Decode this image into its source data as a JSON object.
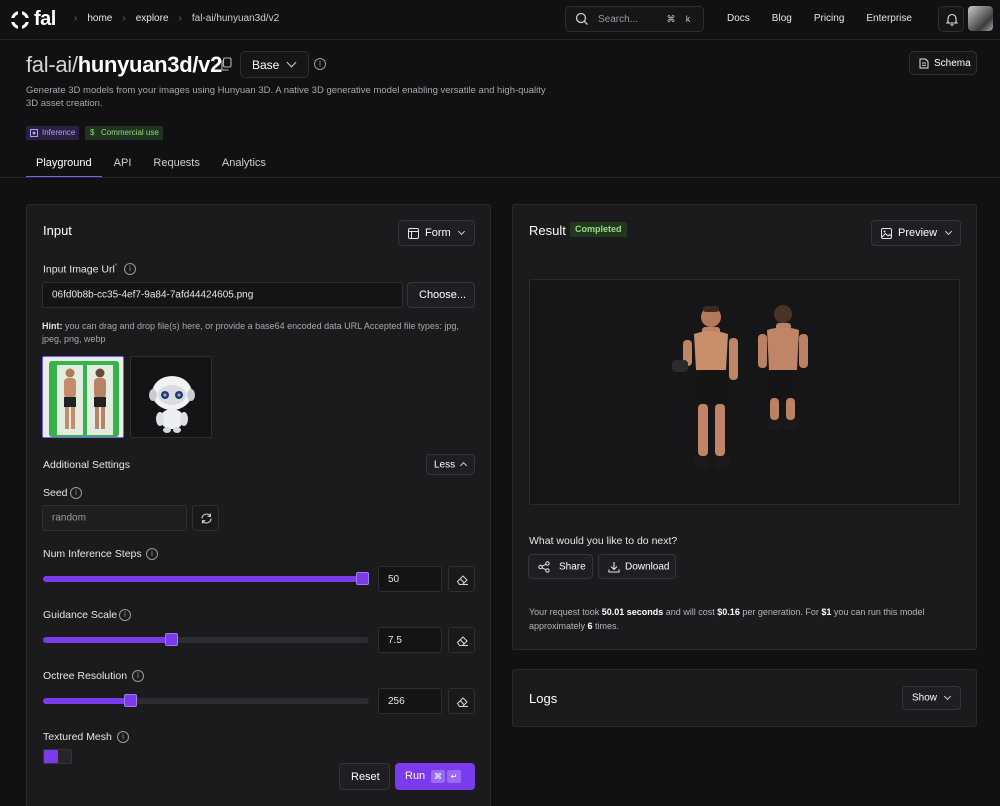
{
  "nav": {
    "logo": "fal",
    "breadcrumbs": [
      "home",
      "explore",
      "fal-ai/hunyuan3d/v2"
    ],
    "search_placeholder": "Search...",
    "search_kbd": [
      "⌘",
      "k"
    ],
    "links": [
      "Docs",
      "Blog",
      "Pricing",
      "Enterprise"
    ]
  },
  "model": {
    "owner": "fal-ai/",
    "name": "hunyuan3d/v2",
    "variant": "Base",
    "schema_label": "Schema",
    "description": "Generate 3D models from your images using Hunyuan 3D. A native 3D generative model enabling versatile and high-quality 3D asset creation.",
    "badges": [
      "Inference",
      "Commercial use"
    ]
  },
  "tabs": [
    "Playground",
    "API",
    "Requests",
    "Analytics"
  ],
  "input": {
    "title": "Input",
    "mode": "Form",
    "image_url_label": "Input Image Url",
    "image_url_required": "*",
    "image_url_value": "06fd0b8b-cc35-4ef7-9a84-7afd44424605.png",
    "choose_label": "Choose...",
    "hint_bold": "Hint:",
    "hint_text": " you can drag and drop file(s) here, or provide a base64 encoded data URL Accepted file types: jpg, jpeg, png, webp",
    "additional_settings": "Additional Settings",
    "less_label": "Less",
    "seed_label": "Seed",
    "seed_placeholder": "random",
    "steps_label": "Num Inference Steps",
    "steps_value": "50",
    "steps_fraction": 1.0,
    "guidance_label": "Guidance Scale",
    "guidance_value": "7.5",
    "guidance_fraction": 0.39,
    "octree_label": "Octree Resolution",
    "octree_value": "256",
    "octree_fraction": 0.26,
    "textured_label": "Textured Mesh",
    "reset_label": "Reset",
    "run_label": "Run",
    "run_kbd": [
      "⌘",
      "↵"
    ]
  },
  "result": {
    "title": "Result",
    "status": "Completed",
    "preview_label": "Preview",
    "next_question": "What would you like to do next?",
    "share_label": "Share",
    "download_label": "Download",
    "cost_1": "Your request took ",
    "cost_time": "50.01 seconds",
    "cost_2": " and will cost ",
    "cost_price": "$0.16",
    "cost_3": " per generation. For ",
    "cost_dollar": "$1",
    "cost_4": " you can run this model approximately ",
    "cost_times": "6",
    "cost_5": " times."
  },
  "logs": {
    "title": "Logs",
    "show_label": "Show"
  },
  "colors": {
    "accent": "#7c3aed",
    "background": "#111113",
    "panel": "#1b1b1e",
    "completed": "#98dd82"
  }
}
